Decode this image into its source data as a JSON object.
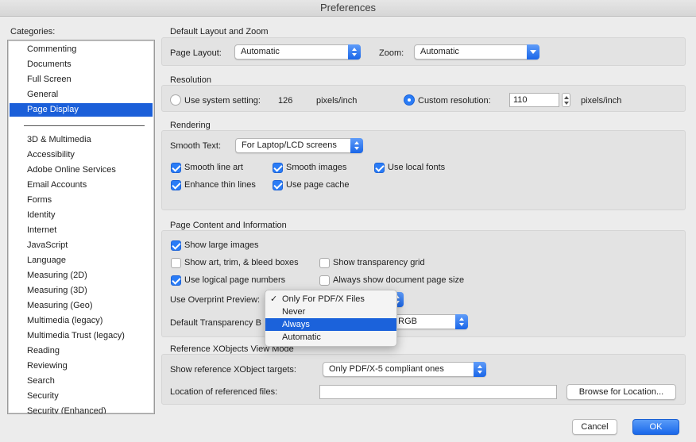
{
  "window": {
    "title": "Preferences"
  },
  "categories": {
    "label": "Categories:",
    "items": [
      "Commenting",
      "Documents",
      "Full Screen",
      "General",
      "Page Display",
      "3D & Multimedia",
      "Accessibility",
      "Adobe Online Services",
      "Email Accounts",
      "Forms",
      "Identity",
      "Internet",
      "JavaScript",
      "Language",
      "Measuring (2D)",
      "Measuring (3D)",
      "Measuring (Geo)",
      "Multimedia (legacy)",
      "Multimedia Trust (legacy)",
      "Reading",
      "Reviewing",
      "Search",
      "Security",
      "Security (Enhanced)"
    ],
    "selected": "Page Display"
  },
  "layout_zoom": {
    "title": "Default Layout and Zoom",
    "page_layout_label": "Page Layout:",
    "page_layout_value": "Automatic",
    "zoom_label": "Zoom:",
    "zoom_value": "Automatic"
  },
  "resolution": {
    "title": "Resolution",
    "system_label": "Use system setting:",
    "system_value": "126",
    "system_unit": "pixels/inch",
    "custom_label": "Custom resolution:",
    "custom_value": "110",
    "custom_unit": "pixels/inch",
    "selected": "custom"
  },
  "rendering": {
    "title": "Rendering",
    "smooth_text_label": "Smooth Text:",
    "smooth_text_value": "For Laptop/LCD screens",
    "smooth_line_art": "Smooth line art",
    "smooth_images": "Smooth images",
    "use_local_fonts": "Use local fonts",
    "enhance_thin_lines": "Enhance thin lines",
    "use_page_cache": "Use page cache"
  },
  "page_content": {
    "title": "Page Content and Information",
    "show_large_images": "Show large images",
    "show_art_trim": "Show art, trim, & bleed boxes",
    "show_transparency_grid": "Show transparency grid",
    "use_logical_numbers": "Use logical page numbers",
    "always_show_size": "Always show document page size",
    "overprint_label": "Use Overprint Preview:",
    "transparency_label": "Default Transparency B",
    "transparency_value": "g RGB"
  },
  "overprint_menu": {
    "items": [
      "Only For PDF/X Files",
      "Never",
      "Always",
      "Automatic"
    ],
    "checked": "Only For PDF/X Files",
    "highlighted": "Always",
    "check_glyph": "✓"
  },
  "xobjects": {
    "title": "Reference XObjects View Mode",
    "targets_label": "Show reference XObject targets:",
    "targets_value": "Only PDF/X-5 compliant ones",
    "location_label": "Location of referenced files:",
    "location_value": "",
    "browse_label": "Browse for Location..."
  },
  "footer": {
    "cancel_label": "Cancel",
    "ok_label": "OK"
  },
  "colors": {
    "accent": "#1b5fd9",
    "panel": "#e3e3e3",
    "background": "#ececec"
  }
}
